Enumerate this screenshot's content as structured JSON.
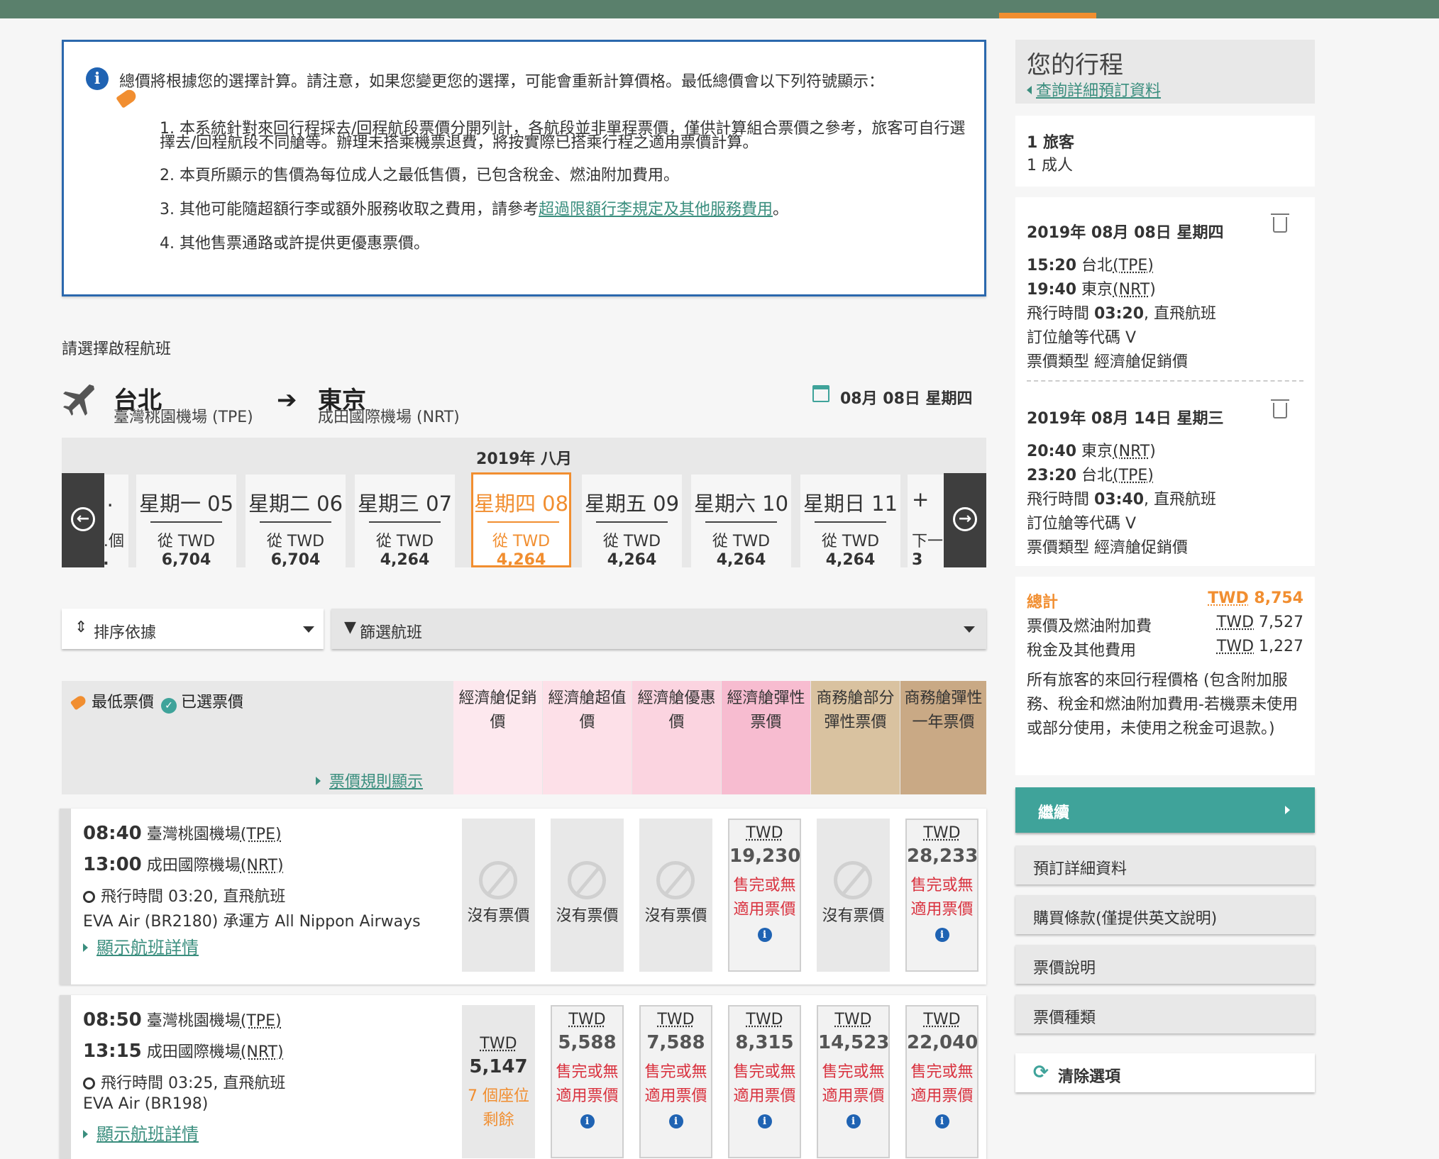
{
  "notice": {
    "headline": "總價將根據您的選擇計算。請注意，如果您變更您的選擇，可能會重新計算價格。最低總價會以下列符號顯示：",
    "items": [
      "1. 本系統針對來回行程採去/回程航段票價分開列計，各航段並非單程票價，僅供計算組合票價之參考，旅客可自行選擇去/回程航段不同艙等。辦理未搭乘機票退費，將按實際已搭乘行程之適用票價計算。",
      "2. 本頁所顯示的售價為每位成人之最低售價，已包含稅金、燃油附加費用。",
      "3. 其他可能隨超額行李或額外服務收取之費用，請參考",
      "4. 其他售票通路或許提供更優惠票價。"
    ],
    "item3_link": "超過限額行李規定及其他服務費用",
    "item3_end": "。"
  },
  "section_label": "請選擇啟程航班",
  "route": {
    "from_city": "台北",
    "from_airport": "臺灣桃園機場 (TPE)",
    "to_city": "東京",
    "to_airport": "成田國際機場 (NRT)",
    "date": "08月 08日 星期四"
  },
  "calendar": {
    "month": "2019年 八月",
    "days": [
      {
        "name": "…",
        "from": "…個",
        "price": "…"
      },
      {
        "name": "星期一 05",
        "from": "從 TWD",
        "price": "6,704"
      },
      {
        "name": "星期二 06",
        "from": "從 TWD",
        "price": "6,704"
      },
      {
        "name": "星期三 07",
        "from": "從 TWD",
        "price": "4,264"
      },
      {
        "name": "星期四 08",
        "from": "從 TWD",
        "price": "4,264"
      },
      {
        "name": "星期五 09",
        "from": "從 TWD",
        "price": "4,264"
      },
      {
        "name": "星期六 10",
        "from": "從 TWD",
        "price": "4,264"
      },
      {
        "name": "星期日 11",
        "from": "從 TWD",
        "price": "4,264"
      },
      {
        "name": "+",
        "from": "下一",
        "price": "3"
      }
    ]
  },
  "toolbar": {
    "sort_label": "排序依據",
    "filter_label": "篩選航班"
  },
  "fare_header": {
    "lowest": "最低票價",
    "selected": "已選票價",
    "rules_link": "票價規則顯示",
    "columns": [
      {
        "label": "經濟艙促銷價",
        "color": "#fde8ee"
      },
      {
        "label": "經濟艙超值價",
        "color": "#fde0e8"
      },
      {
        "label": "經濟艙優惠價",
        "color": "#fbd4e0"
      },
      {
        "label": "經濟艙彈性票價",
        "color": "#f7bcd0"
      },
      {
        "label": "商務艙部分彈性票價",
        "color": "#d9c2a0"
      },
      {
        "label": "商務艙彈性一年票價",
        "color": "#c9a985"
      }
    ]
  },
  "flights": [
    {
      "dep_time": "08:40",
      "dep_airport": "臺灣桃園機場",
      "dep_code": "(TPE)",
      "arr_time": "13:00",
      "arr_airport": "成田國際機場",
      "arr_code": "(NRT)",
      "duration": "飛行時間 03:20, 直飛航班",
      "carrier": "EVA Air (BR2180) 承運方 All Nippon Airways",
      "details": "顯示航班詳情",
      "fares": [
        {
          "type": "none",
          "text": "沒有票價"
        },
        {
          "type": "none",
          "text": "沒有票價"
        },
        {
          "type": "none",
          "text": "沒有票價"
        },
        {
          "type": "fare",
          "cur": "TWD",
          "amt": "19,230",
          "status": "售完或無適用票價"
        },
        {
          "type": "none",
          "text": "沒有票價"
        },
        {
          "type": "fare",
          "cur": "TWD",
          "amt": "28,233",
          "status": "售完或無適用票價"
        }
      ]
    },
    {
      "dep_time": "08:50",
      "dep_airport": "臺灣桃園機場",
      "dep_code": "(TPE)",
      "arr_time": "13:15",
      "arr_airport": "成田國際機場",
      "arr_code": "(NRT)",
      "duration": "飛行時間 03:25, 直飛航班",
      "carrier": "EVA Air (BR198)",
      "details": "顯示航班詳情",
      "fares": [
        {
          "type": "seats",
          "cur": "TWD",
          "amt": "5,147",
          "status": "7 個座位剩餘"
        },
        {
          "type": "fare",
          "cur": "TWD",
          "amt": "5,588",
          "status": "售完或無適用票價"
        },
        {
          "type": "fare",
          "cur": "TWD",
          "amt": "7,588",
          "status": "售完或無適用票價"
        },
        {
          "type": "fare",
          "cur": "TWD",
          "amt": "8,315",
          "status": "售完或無適用票價"
        },
        {
          "type": "fare",
          "cur": "TWD",
          "amt": "14,523",
          "status": "售完或無適用票價"
        },
        {
          "type": "fare",
          "cur": "TWD",
          "amt": "22,040",
          "status": "售完或無適用票價"
        }
      ]
    }
  ],
  "sidebar": {
    "title": "您的行程",
    "booking_link": "查詢詳細預訂資料",
    "passengers_title": "1 旅客",
    "passengers_detail": "1 成人",
    "outbound": {
      "date": "2019年 08月 08日 星期四",
      "dep_time": "15:20",
      "dep_city": "台北",
      "dep_code": "(TPE)",
      "arr_time": "19:40",
      "arr_city": "東京",
      "arr_code": "(NRT)",
      "duration_pre": "飛行時間 ",
      "duration": "03:20",
      "duration_post": ", 直飛航班",
      "booking_class": "訂位艙等代碼 V",
      "fare_type": "票價類型 經濟艙促銷價"
    },
    "inbound": {
      "date": "2019年 08月 14日 星期三",
      "dep_time": "20:40",
      "dep_city": "東京",
      "dep_code": "(NRT)",
      "arr_time": "23:20",
      "arr_city": "台北",
      "arr_code": "(TPE)",
      "duration_pre": "飛行時間 ",
      "duration": "03:40",
      "duration_post": ", 直飛航班",
      "booking_class": "訂位艙等代碼 V",
      "fare_type": "票價類型 經濟艙促銷價"
    },
    "totals": {
      "total_label": "總計",
      "total_cur": "TWD",
      "total_amt": "8,754",
      "fare_label": "票價及燃油附加費",
      "fare_cur": "TWD",
      "fare_amt": "7,527",
      "tax_label": "稅金及其他費用",
      "tax_cur": "TWD",
      "tax_amt": "1,227",
      "desc": "所有旅客的來回行程價格 (包含附加服務、稅金和燃油附加費用-若機票未使用或部分使用，未使用之稅金可退款。)"
    },
    "continue_label": "繼續",
    "buttons": [
      "預訂詳細資料",
      "購買條款(僅提供英文說明)",
      "票價說明",
      "票價種類"
    ],
    "clear_label": "清除選項"
  }
}
